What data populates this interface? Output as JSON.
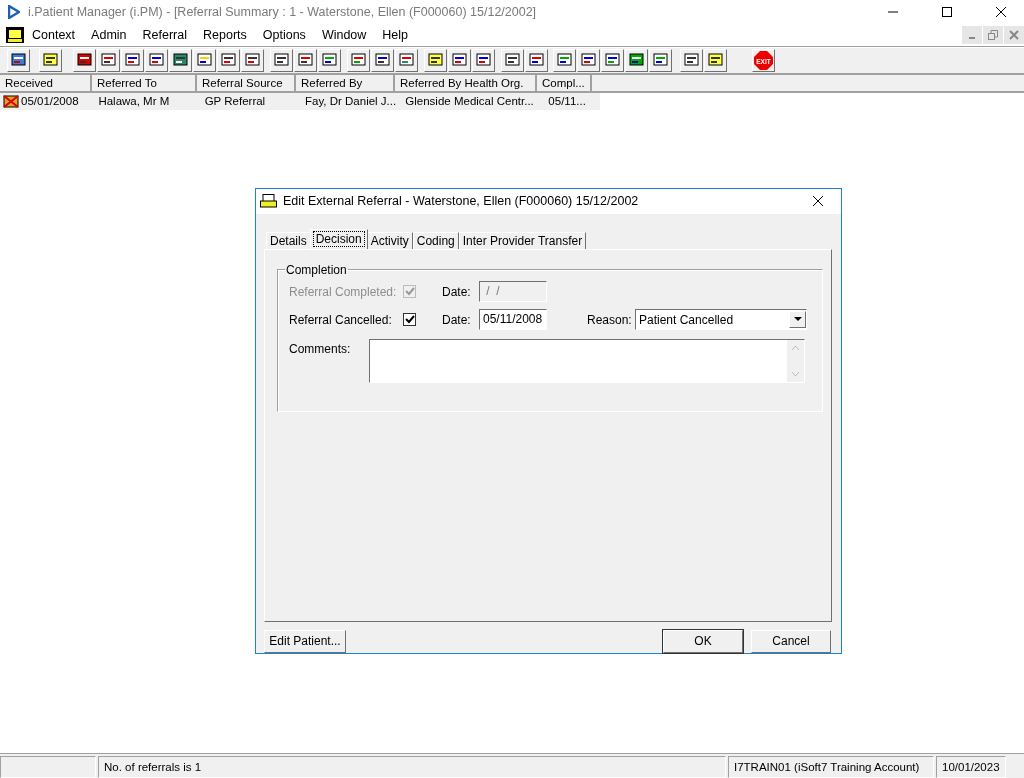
{
  "window": {
    "title": "i.Patient Manager (i.PM) - [Referral Summary : 1 - Waterstone, Ellen (F000060) 15/12/2002]"
  },
  "menu": [
    "Context",
    "Admin",
    "Referral",
    "Reports",
    "Options",
    "Window",
    "Help"
  ],
  "toolbar": {
    "exit_label": "EXIT"
  },
  "table": {
    "columns": [
      "Received",
      "Referred To",
      "Referral Source",
      "Referred By",
      "Referred By Health Org.",
      "Compl..."
    ],
    "rows": [
      {
        "selected": true,
        "cells": [
          "05/01/2008",
          "Halawa, Mr M",
          "GP Referral",
          "Fay, Dr Daniel J...",
          "Glenside Medical Centr...",
          "05/11..."
        ]
      }
    ]
  },
  "dialog": {
    "title": "Edit External Referral - Waterstone, Ellen (F000060) 15/12/2002",
    "tabs": [
      {
        "label": "Details",
        "selected": false
      },
      {
        "label": "Decision",
        "selected": true
      },
      {
        "label": "Activity",
        "selected": false
      },
      {
        "label": "Coding",
        "selected": false
      },
      {
        "label": "Inter Provider Transfer",
        "selected": false
      }
    ],
    "group_title": "Completion",
    "completed": {
      "label": "Referral Completed:",
      "checked": true,
      "disabled": true,
      "date_label": "Date:",
      "date": " /  /"
    },
    "cancelled": {
      "label": "Referral Cancelled:",
      "checked": true,
      "disabled": false,
      "date_label": "Date:",
      "date": "05/11/2008",
      "reason_label": "Reason:",
      "reason": "Patient Cancelled"
    },
    "comments_label": "Comments:",
    "buttons": {
      "left": "Edit Patient...",
      "ok": "OK",
      "cancel": "Cancel"
    }
  },
  "status_bar": [
    "No. of referrals is 1",
    "I7TRAIN01 (iSoft7 Training Account)",
    "10/01/2023"
  ]
}
